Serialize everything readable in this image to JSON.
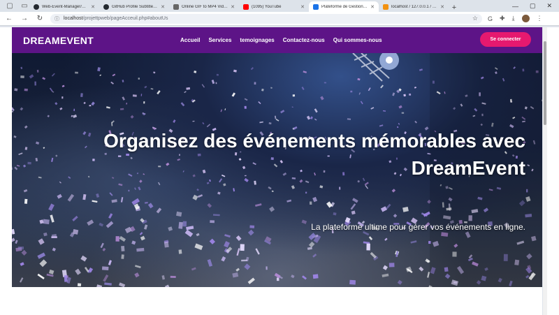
{
  "browser": {
    "tabs": [
      {
        "label": "Web-Event-Manager/REA",
        "color": "#24292f",
        "active": false
      },
      {
        "label": "GitHub Profile Subtitle Ido",
        "color": "#24292f",
        "active": false
      },
      {
        "label": "Online GIF to MP4 Video c",
        "color": "#555555",
        "active": false
      },
      {
        "label": "(1095) YouTube",
        "color": "#ff0000",
        "active": false
      },
      {
        "label": "Plateforme de Gestion d'É",
        "color": "#1a73e8",
        "active": true
      },
      {
        "label": "localhost / 127.0.0.1 / proj",
        "color": "#f29111",
        "active": false
      }
    ],
    "url_host": "localhost",
    "url_path": "/projettpweb/pageAcceuil.php#aboutUs"
  },
  "navbar": {
    "brand": "DREAMEVENT",
    "links": [
      "Accueil",
      "Services",
      "temoignages",
      "Contactez-nous",
      "Qui sommes-nous"
    ],
    "login": "Se connecter"
  },
  "hero": {
    "title_line1": "Organisez des événements mémorables avec",
    "title_line2": "DreamEvent",
    "subtitle": "La plateforme ultime pour gérer vos événements en ligne."
  },
  "colors": {
    "navbar": "#5d1487",
    "login_button": "#e6196f"
  }
}
